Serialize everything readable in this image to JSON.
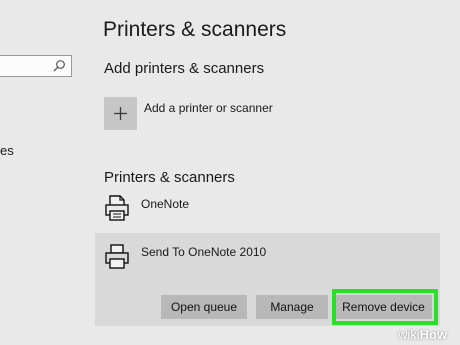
{
  "sidebar": {
    "search_placeholder": "",
    "search_icon": "search-icon",
    "fragment_text": "es"
  },
  "page": {
    "title": "Printers & scanners"
  },
  "add_section": {
    "title": "Add printers & scanners",
    "add_button_icon": "plus-icon",
    "add_button_label": "Add a printer or scanner"
  },
  "printers_section": {
    "title": "Printers & scanners",
    "devices": [
      {
        "name": "OneNote",
        "icon": "printer-icon"
      },
      {
        "name": "Send To OneNote 2010",
        "icon": "printer-icon"
      }
    ],
    "actions": {
      "open_queue": "Open queue",
      "manage": "Manage",
      "remove_device": "Remove device"
    }
  },
  "watermark": {
    "wiki": "wiki",
    "how": "How"
  },
  "colors": {
    "background": "#e9e9e9",
    "selected_panel": "#d9d9d9",
    "button": "#b8b8b8",
    "highlight": "#27e027"
  }
}
